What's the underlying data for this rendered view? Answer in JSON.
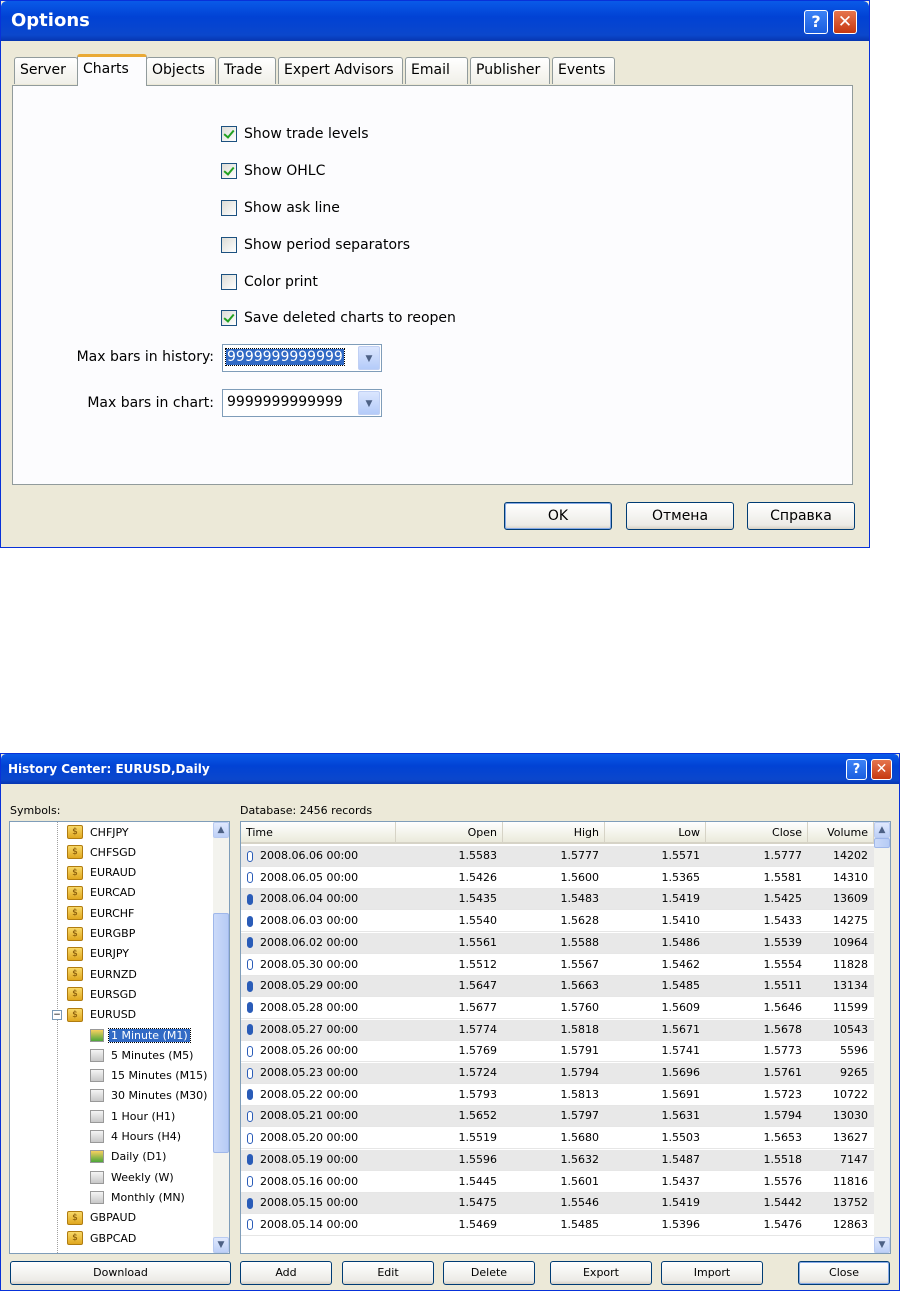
{
  "options": {
    "title": "Options",
    "tabs": [
      "Server",
      "Charts",
      "Objects",
      "Trade",
      "Expert Advisors",
      "Email",
      "Publisher",
      "Events"
    ],
    "active_tab": "Charts",
    "checkboxes": [
      {
        "label": "Show trade levels",
        "checked": true
      },
      {
        "label": "Show OHLC",
        "checked": true
      },
      {
        "label": "Show ask line",
        "checked": false
      },
      {
        "label": "Show period separators",
        "checked": false
      },
      {
        "label": "Color print",
        "checked": false
      },
      {
        "label": "Save deleted charts to reopen",
        "checked": true
      }
    ],
    "max_bars_history_label": "Max bars in history:",
    "max_bars_history_value": "9999999999999",
    "max_bars_chart_label": "Max bars in chart:",
    "max_bars_chart_value": "9999999999999",
    "ok": "OK",
    "cancel": "Отмена",
    "help": "Справка"
  },
  "history": {
    "title": "History Center: EURUSD,Daily",
    "symbols_label": "Symbols:",
    "database_label": "Database: 2456 records",
    "symbols": [
      "CHFJPY",
      "CHFSGD",
      "EURAUD",
      "EURCAD",
      "EURCHF",
      "EURGBP",
      "EURJPY",
      "EURNZD",
      "EURSGD",
      "EURUSD"
    ],
    "timeframes": [
      "1 Minute (M1)",
      "5 Minutes (M5)",
      "15 Minutes (M15)",
      "30 Minutes (M30)",
      "1 Hour (H1)",
      "4 Hours (H4)",
      "Daily (D1)",
      "Weekly (W)",
      "Monthly (MN)"
    ],
    "symbols_after": [
      "GBPAUD",
      "GBPCAD"
    ],
    "columns": [
      "Time",
      "Open",
      "High",
      "Low",
      "Close",
      "Volume"
    ],
    "rows": [
      [
        "2008.06.06 00:00",
        "1.5583",
        "1.5777",
        "1.5571",
        "1.5777",
        "14202"
      ],
      [
        "2008.06.05 00:00",
        "1.5426",
        "1.5600",
        "1.5365",
        "1.5581",
        "14310"
      ],
      [
        "2008.06.04 00:00",
        "1.5435",
        "1.5483",
        "1.5419",
        "1.5425",
        "13609"
      ],
      [
        "2008.06.03 00:00",
        "1.5540",
        "1.5628",
        "1.5410",
        "1.5433",
        "14275"
      ],
      [
        "2008.06.02 00:00",
        "1.5561",
        "1.5588",
        "1.5486",
        "1.5539",
        "10964"
      ],
      [
        "2008.05.30 00:00",
        "1.5512",
        "1.5567",
        "1.5462",
        "1.5554",
        "11828"
      ],
      [
        "2008.05.29 00:00",
        "1.5647",
        "1.5663",
        "1.5485",
        "1.5511",
        "13134"
      ],
      [
        "2008.05.28 00:00",
        "1.5677",
        "1.5760",
        "1.5609",
        "1.5646",
        "11599"
      ],
      [
        "2008.05.27 00:00",
        "1.5774",
        "1.5818",
        "1.5671",
        "1.5678",
        "10543"
      ],
      [
        "2008.05.26 00:00",
        "1.5769",
        "1.5791",
        "1.5741",
        "1.5773",
        "5596"
      ],
      [
        "2008.05.23 00:00",
        "1.5724",
        "1.5794",
        "1.5696",
        "1.5761",
        "9265"
      ],
      [
        "2008.05.22 00:00",
        "1.5793",
        "1.5813",
        "1.5691",
        "1.5723",
        "10722"
      ],
      [
        "2008.05.21 00:00",
        "1.5652",
        "1.5797",
        "1.5631",
        "1.5794",
        "13030"
      ],
      [
        "2008.05.20 00:00",
        "1.5519",
        "1.5680",
        "1.5503",
        "1.5653",
        "13627"
      ],
      [
        "2008.05.19 00:00",
        "1.5596",
        "1.5632",
        "1.5487",
        "1.5518",
        "7147"
      ],
      [
        "2008.05.16 00:00",
        "1.5445",
        "1.5601",
        "1.5437",
        "1.5576",
        "11816"
      ],
      [
        "2008.05.15 00:00",
        "1.5475",
        "1.5546",
        "1.5419",
        "1.5442",
        "13752"
      ],
      [
        "2008.05.14 00:00",
        "1.5469",
        "1.5485",
        "1.5396",
        "1.5476",
        "12863"
      ]
    ],
    "buttons": {
      "download": "Download",
      "add": "Add",
      "edit": "Edit",
      "delete": "Delete",
      "export": "Export",
      "import": "Import",
      "close": "Close"
    }
  }
}
